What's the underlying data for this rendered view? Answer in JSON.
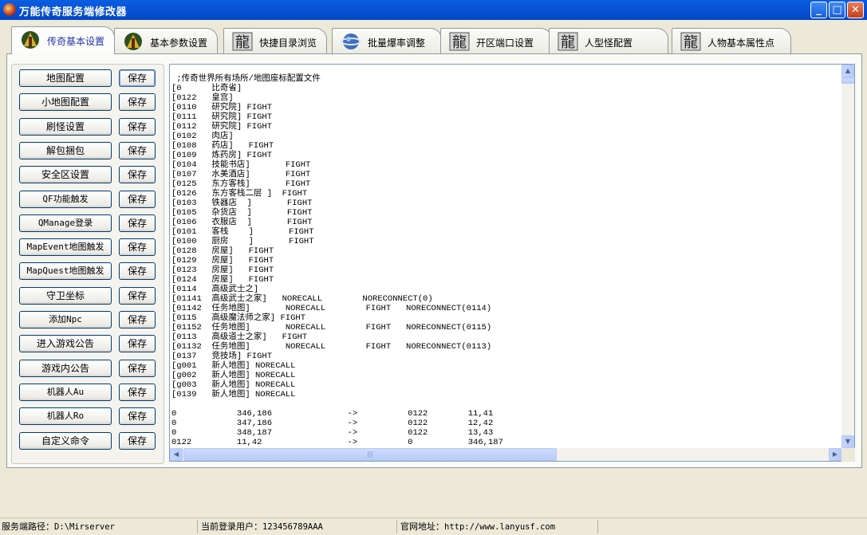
{
  "window": {
    "title": "万能传奇服务端修改器",
    "minimize_glyph": "_",
    "maximize_glyph": "□",
    "close_glyph": "✕"
  },
  "tabs": [
    {
      "label": "传奇基本设置",
      "icon": "mir-warrior-icon",
      "active": true
    },
    {
      "label": "基本参数设置",
      "icon": "mir-warrior-icon",
      "active": false
    },
    {
      "label": "快捷目录浏览",
      "icon": "dragon-char-icon",
      "active": false
    },
    {
      "label": "批量爆率调整",
      "icon": "globe-swirl-icon",
      "active": false
    },
    {
      "label": "开区端口设置",
      "icon": "dragon-char-icon",
      "active": false
    },
    {
      "label": "人型怪配置",
      "icon": "dragon-char-icon",
      "active": false
    },
    {
      "label": "人物基本属性点",
      "icon": "dragon-char-icon",
      "active": false
    }
  ],
  "left_buttons": [
    {
      "label": "地图配置",
      "save": "保存"
    },
    {
      "label": "小地图配置",
      "save": "保存"
    },
    {
      "label": "刷怪设置",
      "save": "保存"
    },
    {
      "label": "解包捆包",
      "save": "保存"
    },
    {
      "label": "安全区设置",
      "save": "保存"
    },
    {
      "label": "QF功能触发",
      "save": "保存"
    },
    {
      "label": "QManage登录",
      "save": "保存"
    },
    {
      "label": "MapEvent地图触发",
      "save": "保存"
    },
    {
      "label": "MapQuest地图触发",
      "save": "保存"
    },
    {
      "label": "守卫坐标",
      "save": "保存"
    },
    {
      "label": "添加Npc",
      "save": "保存"
    },
    {
      "label": "进入游戏公告",
      "save": "保存"
    },
    {
      "label": "游戏内公告",
      "save": "保存"
    },
    {
      "label": "机器人Au",
      "save": "保存"
    },
    {
      "label": "机器人Ro",
      "save": "保存"
    },
    {
      "label": "自定义命令",
      "save": "保存"
    }
  ],
  "editor_lines": [
    " ;传奇世界所有场所/地图座标配置文件",
    "[0      比奇省]",
    "[0122   皇宫]",
    "[0110   研究院] FIGHT",
    "[0111   研究院] FIGHT",
    "[0112   研究院] FIGHT",
    "[0102   肉店]",
    "[0108   药店]   FIGHT",
    "[0109   炼药房] FIGHT",
    "[0104   技能书店]       FIGHT",
    "[0107   水美酒店]       FIGHT",
    "[0125   东方客栈]       FIGHT",
    "[0126   东方客栈二层 ]  FIGHT",
    "[0103   铁器店  ]       FIGHT",
    "[0105   杂货店  ]       FIGHT",
    "[0106   衣服店  ]       FIGHT",
    "[0101   客栈    ]       FIGHT",
    "[0100   厨房    ]       FIGHT",
    "[0128   房屋]   FIGHT",
    "[0129   房屋]   FIGHT",
    "[0123   房屋]   FIGHT",
    "[0124   房屋]   FIGHT",
    "[0114   高级武士之]",
    "[01141  高级武士之家]   NORECALL        NORECONNECT(0)",
    "[01142  任务地图]       NORECALL        FIGHT   NORECONNECT(0114)",
    "[0115   高级魔法师之家] FIGHT",
    "[01152  任务地图]       NORECALL        FIGHT   NORECONNECT(0115)",
    "[0113   高级道士之家]   FIGHT",
    "[01132  任务地图]       NORECALL        FIGHT   NORECONNECT(0113)",
    "[0137   竞技场] FIGHT",
    "[g001   新人地图] NORECALL",
    "[g002   新人地图] NORECALL",
    "[g003   新人地图] NORECALL",
    "[0139   新人地图] NORECALL",
    "",
    "0            346,186               ->          0122        11,41",
    "0            347,186               ->          0122        12,42",
    "0            348,187               ->          0122        13,43",
    "0122         11,42                 ->          0           346,187"
  ],
  "scrollbars": {
    "up_arrow": "▲",
    "down_arrow": "▼",
    "left_arrow": "◀",
    "right_arrow": "▶",
    "grip": "|||"
  },
  "status": {
    "server_path_label": "服务端路径：",
    "server_path_value": "D:\\Mirserver",
    "user_label": "当前登录用户：",
    "user_value": "123456789AAA",
    "site_label": "官网地址：",
    "site_value": "http://www.lanyusf.com"
  },
  "colors": {
    "titlebar": "#0854d6",
    "face": "#ece9d8",
    "active_tab_text": "#2233aa",
    "button_border": "#003c74"
  }
}
